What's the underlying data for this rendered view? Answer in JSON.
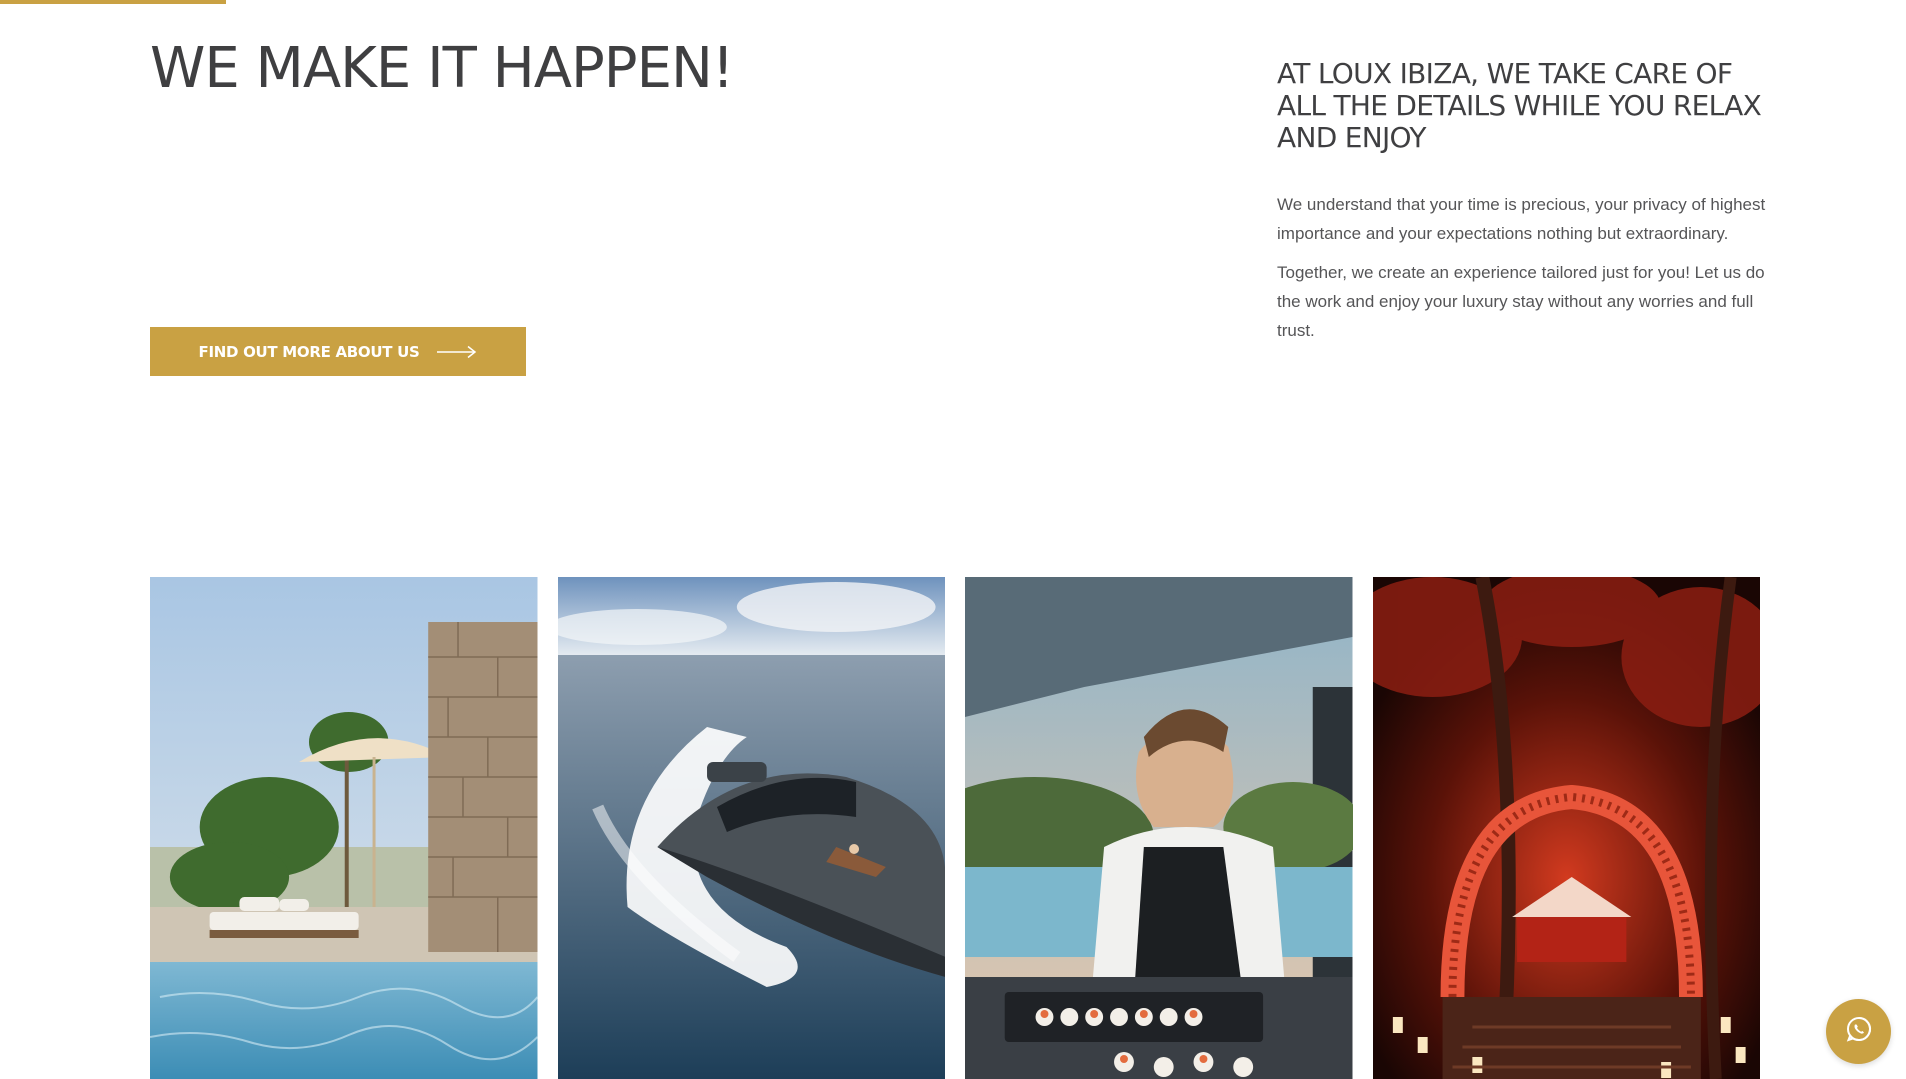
{
  "colors": {
    "accent": "#c9a143",
    "heading": "#3f3f41",
    "body_text": "#555557",
    "background": "#ffffff"
  },
  "hero": {
    "title": "WE MAKE IT HAPPEN!",
    "cta_label": "FIND OUT MORE ABOUT US",
    "cta_icon": "arrow-right-icon"
  },
  "intro": {
    "heading": "AT LOUX IBIZA, WE TAKE CARE OF ALL THE DETAILS WHILE YOU RELAX AND ENJOY",
    "paragraphs": [
      "We understand that your time is precious, your privacy of highest importance and your expectations nothing but extraordinary.",
      "Together, we create an experience tailored just for you! Let us do the work and enjoy your luxury stay without any worries and full trust."
    ]
  },
  "gallery": {
    "tiles": [
      {
        "icon": "villa-pool-photo"
      },
      {
        "icon": "yacht-photo"
      },
      {
        "icon": "private-chef-photo"
      },
      {
        "icon": "night-event-photo"
      }
    ]
  },
  "floating": {
    "icon": "whatsapp-icon"
  }
}
